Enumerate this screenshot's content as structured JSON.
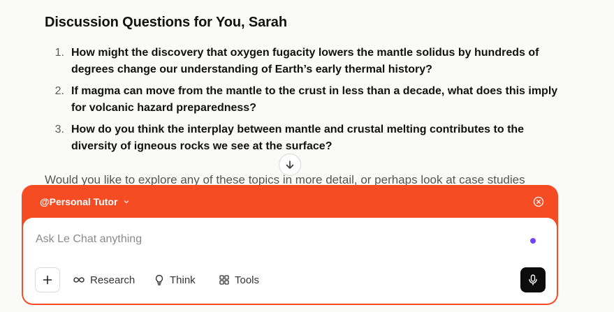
{
  "message": {
    "heading": "Discussion Questions for You, Sarah",
    "questions": [
      {
        "num": "1.",
        "text": "How might the discovery that oxygen fugacity lowers the mantle solidus by hundreds of degrees change our understanding of Earth’s early thermal history?"
      },
      {
        "num": "2.",
        "text": "If magma can move from the mantle to the crust in less than a decade, what does this imply for volcanic hazard preparedness?"
      },
      {
        "num": "3.",
        "text": "How do you think the interplay between mantle and crustal melting contributes to the diversity of igneous rocks we see at the surface?"
      }
    ],
    "followup": "Would you like to explore any of these topics in more detail, or perhaps look at case studies"
  },
  "composer": {
    "agent_label": "@Personal Tutor",
    "placeholder": "Ask Le Chat anything",
    "tools": {
      "research": "Research",
      "think": "Think",
      "tools": "Tools"
    },
    "accent_color": "#f64c23",
    "indicator_color": "#6c47ff"
  },
  "icons": {
    "scroll": "arrow-down-icon",
    "agent_dropdown": "chevron-down-icon",
    "close": "close-circle-icon",
    "add": "plus-icon",
    "research": "infinity-icon",
    "think": "lightbulb-icon",
    "tools": "grid-icon",
    "mic": "microphone-icon"
  }
}
